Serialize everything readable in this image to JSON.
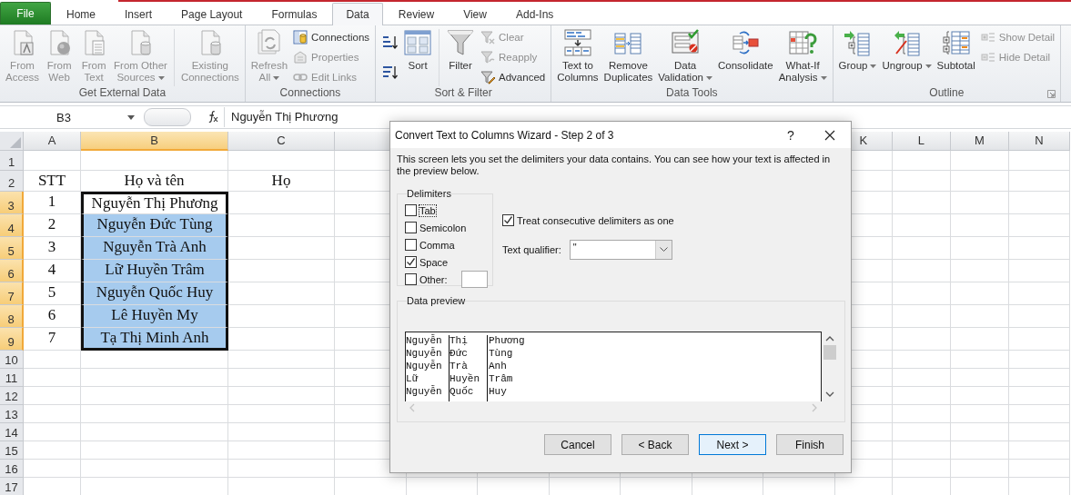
{
  "ribbon_tabs": [
    {
      "label": "File",
      "kind": "file",
      "selected": false
    },
    {
      "label": "Home",
      "kind": "tab",
      "selected": false
    },
    {
      "label": "Insert",
      "kind": "tab",
      "selected": false
    },
    {
      "label": "Page Layout",
      "kind": "tab",
      "selected": false
    },
    {
      "label": "Formulas",
      "kind": "tab",
      "selected": false
    },
    {
      "label": "Data",
      "kind": "tab",
      "selected": true
    },
    {
      "label": "Review",
      "kind": "tab",
      "selected": false
    },
    {
      "label": "View",
      "kind": "tab",
      "selected": false
    },
    {
      "label": "Add-Ins",
      "kind": "tab",
      "selected": false
    }
  ],
  "ribbon_groups": [
    {
      "title": "Get External Data",
      "items": [
        {
          "kind": "large",
          "label": "From\nAccess",
          "disabled": true,
          "dropdown": false
        },
        {
          "kind": "large",
          "label": "From\nWeb",
          "disabled": true,
          "dropdown": false
        },
        {
          "kind": "large",
          "label": "From\nText",
          "disabled": true,
          "dropdown": false
        },
        {
          "kind": "large",
          "label": "From Other\nSources",
          "disabled": true,
          "dropdown": true
        },
        {
          "kind": "separator"
        },
        {
          "kind": "large",
          "label": "Existing\nConnections",
          "disabled": true,
          "dropdown": false
        }
      ]
    },
    {
      "title": "Connections",
      "items": [
        {
          "kind": "large",
          "label": "Refresh\nAll",
          "disabled": true,
          "dropdown": true
        },
        {
          "kind": "stack",
          "commands": [
            {
              "kind": "small",
              "label": "Connections",
              "disabled": false
            },
            {
              "kind": "small",
              "label": "Properties",
              "disabled": true
            },
            {
              "kind": "small",
              "label": "Edit Links",
              "disabled": true
            }
          ]
        }
      ]
    },
    {
      "title": "Sort & Filter",
      "items": [
        {
          "kind": "stack",
          "commands": [
            {
              "kind": "icon",
              "disabled": false
            },
            {
              "kind": "icon",
              "disabled": false
            }
          ]
        },
        {
          "kind": "large",
          "label": "Sort",
          "disabled": false,
          "dropdown": false
        },
        {
          "kind": "separator"
        },
        {
          "kind": "large",
          "label": "Filter",
          "disabled": false,
          "dropdown": false
        },
        {
          "kind": "stack",
          "commands": [
            {
              "kind": "small",
              "label": "Clear",
              "disabled": true
            },
            {
              "kind": "small",
              "label": "Reapply",
              "disabled": true
            },
            {
              "kind": "small",
              "label": "Advanced",
              "disabled": false
            }
          ]
        }
      ]
    },
    {
      "title": "Data Tools",
      "items": [
        {
          "kind": "large",
          "label": "Text to\nColumns",
          "disabled": false,
          "dropdown": false
        },
        {
          "kind": "large",
          "label": "Remove\nDuplicates",
          "disabled": false,
          "dropdown": false
        },
        {
          "kind": "large",
          "label": "Data\nValidation",
          "disabled": false,
          "dropdown": true
        },
        {
          "kind": "large",
          "label": "Consolidate",
          "disabled": false,
          "dropdown": false
        },
        {
          "kind": "large",
          "label": "What-If\nAnalysis",
          "disabled": false,
          "dropdown": true
        }
      ]
    },
    {
      "title": "Outline",
      "launcher": true,
      "items": [
        {
          "kind": "large",
          "label": "Group",
          "disabled": false,
          "dropdown": true
        },
        {
          "kind": "large",
          "label": "Ungroup",
          "disabled": false,
          "dropdown": true
        },
        {
          "kind": "large",
          "label": "Subtotal",
          "disabled": false,
          "dropdown": false
        },
        {
          "kind": "stack",
          "commands": [
            {
              "kind": "small",
              "label": "Show Detail",
              "disabled": true
            },
            {
              "kind": "small",
              "label": "Hide Detail",
              "disabled": true
            }
          ]
        }
      ]
    }
  ],
  "formula_bar": {
    "name_box": "B3",
    "value": "Nguyễn Thị Phương"
  },
  "sheet": {
    "columns": [
      {
        "label": "A",
        "selected": false
      },
      {
        "label": "B",
        "selected": true
      },
      {
        "label": "C",
        "selected": false
      },
      {
        "label": "K",
        "selected": false
      },
      {
        "label": "L",
        "selected": false
      },
      {
        "label": "M",
        "selected": false
      },
      {
        "label": "N",
        "selected": false
      }
    ],
    "rows": [
      {
        "header": "1",
        "selected": false
      },
      {
        "header": "2",
        "selected": false,
        "cells": [
          {
            "text": "STT",
            "selected": false
          },
          {
            "text": "Họ và tên",
            "selected": false
          },
          {
            "text": "Họ",
            "selected": false
          }
        ]
      },
      {
        "header": "3",
        "selected": true,
        "cells": [
          {
            "text": "1",
            "selected": false
          },
          {
            "text": "Nguyễn Thị Phương",
            "selected": true,
            "active": true
          }
        ]
      },
      {
        "header": "4",
        "selected": true,
        "cells": [
          {
            "text": "2",
            "selected": false
          },
          {
            "text": "Nguyễn Đức Tùng",
            "selected": true,
            "active": false
          }
        ]
      },
      {
        "header": "5",
        "selected": true,
        "cells": [
          {
            "text": "3",
            "selected": false
          },
          {
            "text": "Nguyễn Trà Anh",
            "selected": true,
            "active": false
          }
        ]
      },
      {
        "header": "6",
        "selected": true,
        "cells": [
          {
            "text": "4",
            "selected": false
          },
          {
            "text": "Lữ Huyền Trâm",
            "selected": true,
            "active": false
          }
        ]
      },
      {
        "header": "7",
        "selected": true,
        "cells": [
          {
            "text": "5",
            "selected": false
          },
          {
            "text": "Nguyễn Quốc Huy",
            "selected": true,
            "active": false
          }
        ]
      },
      {
        "header": "8",
        "selected": true,
        "cells": [
          {
            "text": "6",
            "selected": false
          },
          {
            "text": "Lê Huyền My",
            "selected": true,
            "active": false
          }
        ]
      },
      {
        "header": "9",
        "selected": true,
        "cells": [
          {
            "text": "7",
            "selected": false
          },
          {
            "text": "Tạ Thị Minh Anh",
            "selected": true,
            "active": false
          }
        ]
      },
      {
        "header": "10",
        "selected": false
      },
      {
        "header": "11",
        "selected": false
      },
      {
        "header": "12",
        "selected": false
      },
      {
        "header": "13",
        "selected": false
      },
      {
        "header": "14",
        "selected": false
      },
      {
        "header": "15",
        "selected": false
      },
      {
        "header": "16",
        "selected": false
      },
      {
        "header": "17",
        "selected": false
      }
    ]
  },
  "dialog": {
    "title": "Convert Text to Columns Wizard - Step 2 of 3",
    "help": "?",
    "description": "This screen lets you set the delimiters your data contains.  You can see how your text is affected in the preview below.",
    "delimiters_title": "Delimiters",
    "delimiters": [
      {
        "label": "Tab",
        "checked": false,
        "focused": true
      },
      {
        "label": "Semicolon",
        "checked": false,
        "focused": false
      },
      {
        "label": "Comma",
        "checked": false,
        "focused": false
      },
      {
        "label": "Space",
        "checked": true,
        "focused": false
      },
      {
        "label": "Other:",
        "checked": false,
        "focused": false,
        "has_field": true
      }
    ],
    "treat_consecutive": {
      "label": "Treat consecutive delimiters as one",
      "checked": true
    },
    "text_qualifier": {
      "label": "Text qualifier:",
      "value": "\""
    },
    "preview_title": "Data preview",
    "preview_rows": [
      [
        "Nguyễn",
        "Thị",
        "Phương"
      ],
      [
        "Nguyễn",
        "Đức",
        "Tùng"
      ],
      [
        "Nguyễn",
        "Trà",
        "Anh"
      ],
      [
        "Lữ",
        "Huyền",
        "Trâm"
      ],
      [
        "Nguyễn",
        "Quốc",
        "Huy"
      ]
    ],
    "buttons": [
      {
        "label": "Cancel",
        "default": false
      },
      {
        "label": "< Back",
        "default": false
      },
      {
        "label": "Next >",
        "default": true
      },
      {
        "label": "Finish",
        "default": false
      }
    ]
  }
}
